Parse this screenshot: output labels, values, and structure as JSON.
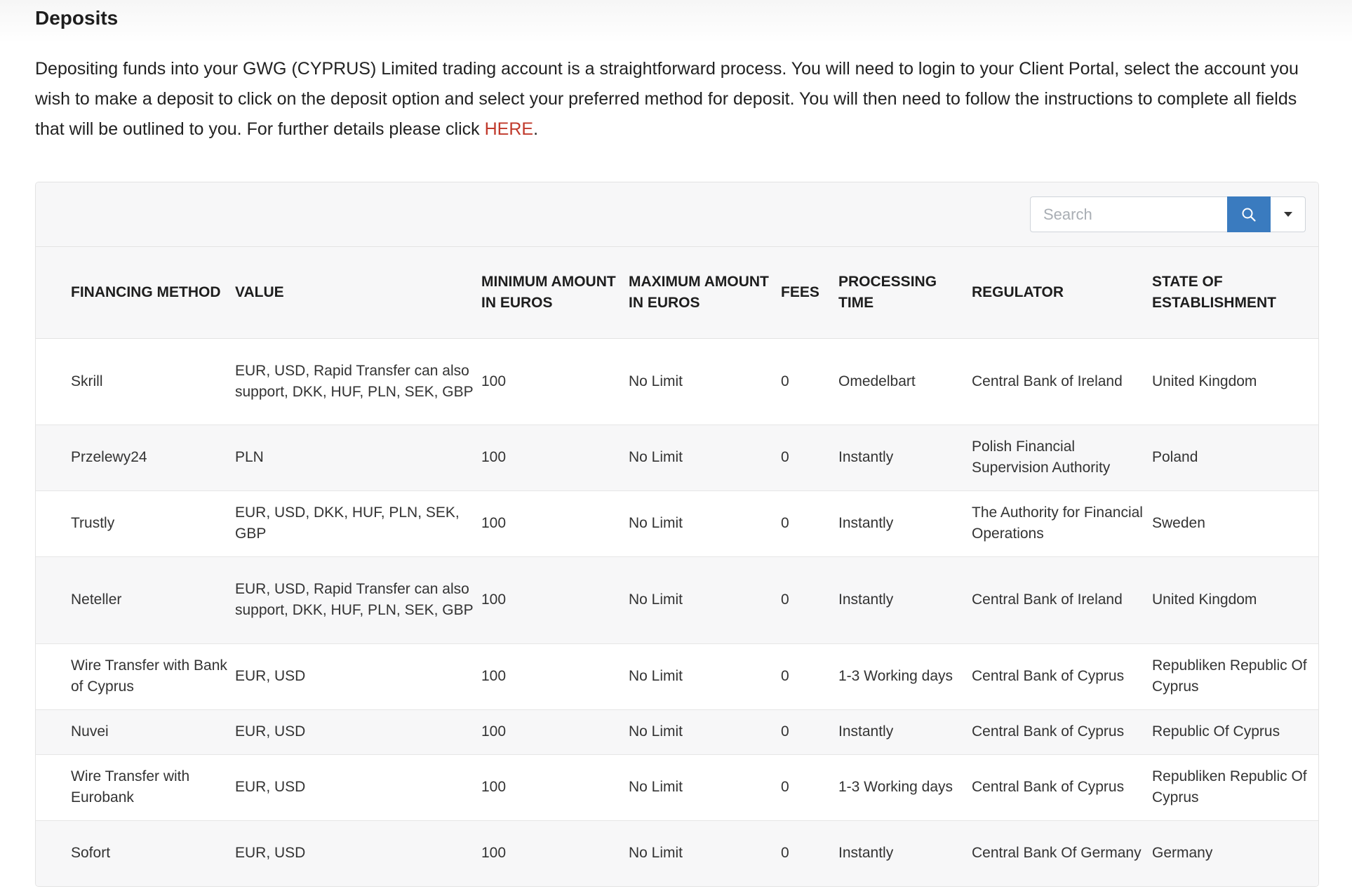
{
  "page": {
    "title": "Deposits",
    "intro_text": "Depositing funds into your GWG (CYPRUS) Limited trading account is a straightforward process. You will need to login to your Client Portal, select the account you wish to make a deposit to click on the deposit option and select your preferred method for deposit. You will then need to follow the instructions to complete all fields that will be outlined to you. For further details please click ",
    "intro_link": "HERE",
    "intro_end": "."
  },
  "toolbar": {
    "search_placeholder": "Search",
    "search_icon": "search-icon",
    "dropdown_icon": "caret-down-icon",
    "accent_color": "#3a7bbf"
  },
  "table": {
    "headers": [
      "FINANCING METHOD",
      "VALUE",
      "MINIMUM AMOUNT IN EUROS",
      "MAXIMUM AMOUNT IN EUROS",
      "FEES",
      "PROCESSING TIME",
      "REGULATOR",
      "STATE OF ESTABLISHMENT"
    ],
    "rows": [
      [
        "Skrill",
        "EUR, USD, Rapid Transfer can also support, DKK, HUF, PLN, SEK, GBP",
        "100",
        "No Limit",
        "0",
        "Omedelbart",
        "Central Bank of Ireland",
        "United Kingdom"
      ],
      [
        "Przelewy24",
        "PLN",
        "100",
        "No Limit",
        "0",
        "Instantly",
        "Polish Financial Supervision Authority",
        "Poland"
      ],
      [
        "Trustly",
        "EUR, USD, DKK, HUF, PLN, SEK, GBP",
        "100",
        "No Limit",
        "0",
        "Instantly",
        "The Authority for Financial Operations",
        "Sweden"
      ],
      [
        "Neteller",
        "EUR, USD, Rapid Transfer can also support, DKK, HUF, PLN, SEK, GBP",
        "100",
        "No Limit",
        "0",
        "Instantly",
        "Central Bank of Ireland",
        "United Kingdom"
      ],
      [
        "Wire Transfer with Bank of Cyprus",
        "EUR, USD",
        "100",
        "No Limit",
        "0",
        "1-3 Working days",
        "Central Bank of Cyprus",
        "Republiken Republic Of Cyprus"
      ],
      [
        "Nuvei",
        "EUR, USD",
        "100",
        "No Limit",
        "0",
        "Instantly",
        "Central Bank of Cyprus",
        "Republic Of Cyprus"
      ],
      [
        "Wire Transfer with Eurobank",
        "EUR, USD",
        "100",
        "No Limit",
        "0",
        "1-3 Working days",
        "Central Bank of Cyprus",
        "Republiken Republic Of Cyprus"
      ],
      [
        "Sofort",
        "EUR, USD",
        "100",
        "No Limit",
        "0",
        "Instantly",
        "Central Bank Of Germany",
        "Germany"
      ]
    ]
  }
}
